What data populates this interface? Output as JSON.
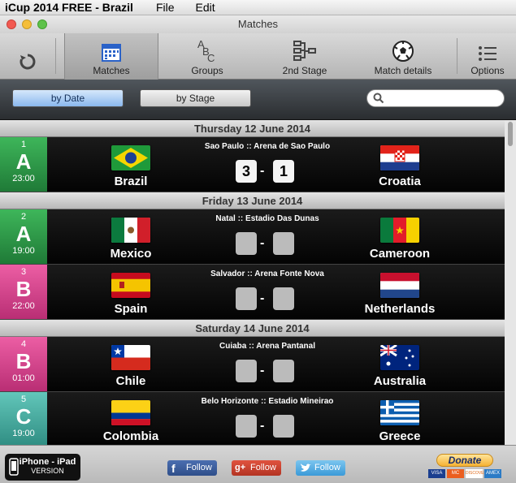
{
  "menubar": {
    "app": "iCup 2014 FREE - Brazil",
    "file": "File",
    "edit": "Edit"
  },
  "window": {
    "title": "Matches"
  },
  "toolbar": {
    "items": [
      {
        "label": "Matches"
      },
      {
        "label": "Groups"
      },
      {
        "label": "2nd Stage"
      },
      {
        "label": "Match details"
      },
      {
        "label": "Options"
      }
    ],
    "refresh_icon": "refresh-icon"
  },
  "filter": {
    "by_date": "by Date",
    "by_stage": "by Stage",
    "search_placeholder": ""
  },
  "days": [
    "Thursday 12 June 2014",
    "Friday 13 June 2014",
    "Saturday 14 June 2014"
  ],
  "matches": [
    {
      "num": "1",
      "group": "A",
      "time": "23:00",
      "home": "Brazil",
      "away": "Croatia",
      "city": "Sao Paulo",
      "stadium": "Arena de Sao Paulo",
      "home_score": "3",
      "away_score": "1",
      "group_color": "#2e9a4a"
    },
    {
      "num": "2",
      "group": "A",
      "time": "19:00",
      "home": "Mexico",
      "away": "Cameroon",
      "city": "Natal",
      "stadium": "Estadio Das Dunas",
      "home_score": "",
      "away_score": "",
      "group_color": "#2e9a4a"
    },
    {
      "num": "3",
      "group": "B",
      "time": "22:00",
      "home": "Spain",
      "away": "Netherlands",
      "city": "Salvador",
      "stadium": "Arena Fonte Nova",
      "home_score": "",
      "away_score": "",
      "group_color": "#d9418c"
    },
    {
      "num": "4",
      "group": "B",
      "time": "01:00",
      "home": "Chile",
      "away": "Australia",
      "city": "Cuiaba",
      "stadium": "Arena Pantanal",
      "home_score": "",
      "away_score": "",
      "group_color": "#d9418c"
    },
    {
      "num": "5",
      "group": "C",
      "time": "19:00",
      "home": "Colombia",
      "away": "Greece",
      "city": "Belo Horizonte",
      "stadium": "Estadio Mineirao",
      "home_score": "",
      "away_score": "",
      "group_color": "#47b0a4"
    }
  ],
  "venue_sep": "::",
  "score_sep": "-",
  "bottom": {
    "device_line1": "iPhone - iPad",
    "device_line2": "VERSION",
    "facebook": "Follow",
    "google": "Follow",
    "twitter": "Follow",
    "donate": "Donate",
    "cards": [
      "VISA",
      "MC",
      "DISCOVER",
      "AMEX"
    ]
  }
}
